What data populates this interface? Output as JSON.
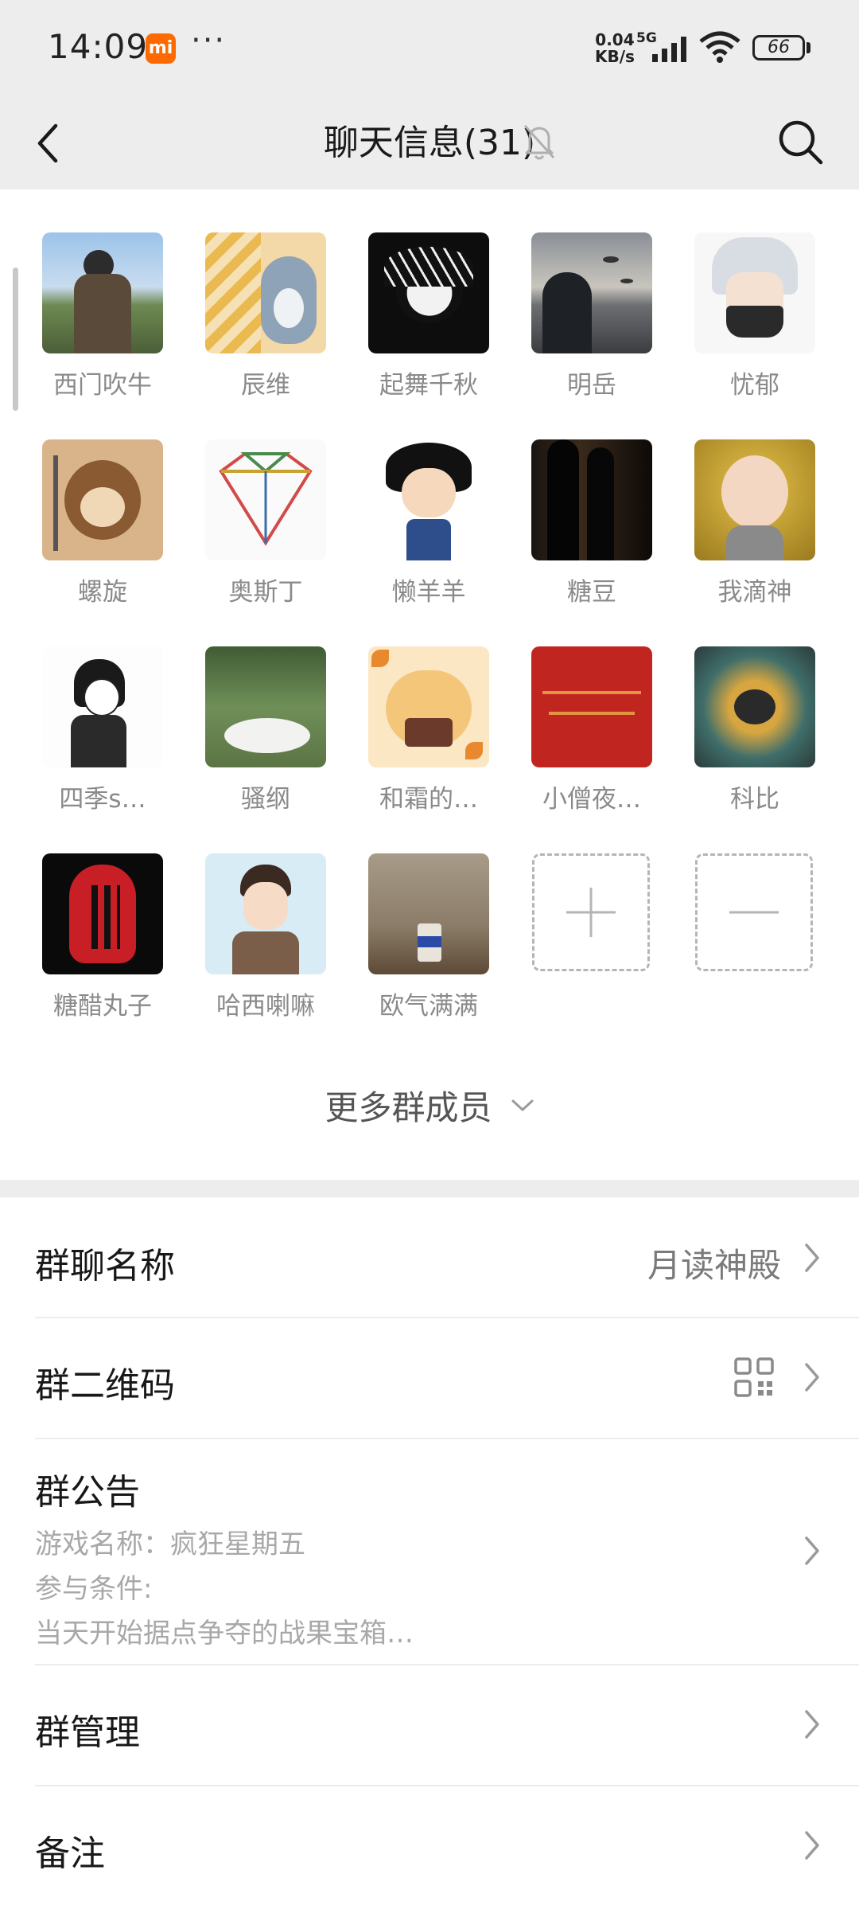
{
  "status_bar": {
    "time": "14:09",
    "mi_badge": "mi",
    "dots": "···",
    "net_speed_value": "0.04",
    "net_speed_unit": "KB/s",
    "network": "5G",
    "battery": "66"
  },
  "header": {
    "title": "聊天信息(31)",
    "icons": [
      "back-icon",
      "mute-bell-icon",
      "search-icon"
    ]
  },
  "members": [
    {
      "name": "西门吹牛"
    },
    {
      "name": "辰维"
    },
    {
      "name": "起舞千秋"
    },
    {
      "name": "明岳"
    },
    {
      "name": "忧郁"
    },
    {
      "name": "螺旋"
    },
    {
      "name": "奥斯丁"
    },
    {
      "name": "懒羊羊"
    },
    {
      "name": "糖豆"
    },
    {
      "name": "我滴神"
    },
    {
      "name": "四季s…"
    },
    {
      "name": "骚纲"
    },
    {
      "name": "和霜的…"
    },
    {
      "name": "小僧夜…"
    },
    {
      "name": "科比"
    },
    {
      "name": "糖醋丸子"
    },
    {
      "name": "哈西喇嘛"
    },
    {
      "name": "欧气满满"
    }
  ],
  "member_controls": {
    "add_icon": "plus-icon",
    "remove_icon": "minus-icon"
  },
  "more_members_label": "更多群成员",
  "settings": {
    "group_name_label": "群聊名称",
    "group_name_value": "月读神殿",
    "qr_label": "群二维码",
    "notice_label": "群公告",
    "notice_lines": [
      "游戏名称：疯狂星期五",
      "参与条件:",
      "当天开始据点争夺的战果宝箱…"
    ],
    "manage_label": "群管理",
    "remark_label": "备注"
  },
  "colors": {
    "accent_orange": "#ff6a00",
    "background": "#ededed",
    "panel": "#ffffff"
  }
}
